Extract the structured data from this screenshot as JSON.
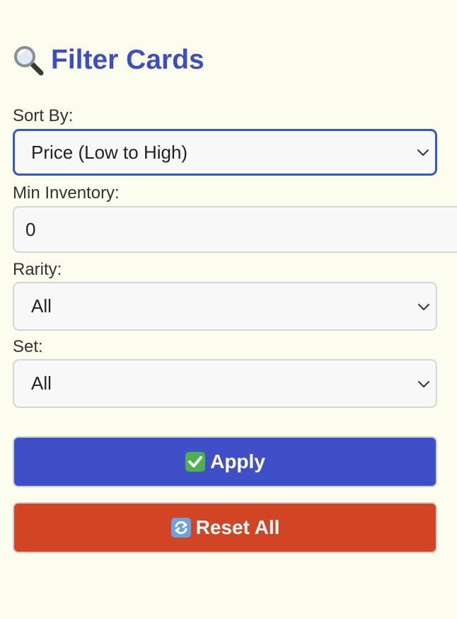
{
  "header": {
    "title": "Filter Cards",
    "title_icon": "magnifying-glass-icon"
  },
  "filters": {
    "sort_by": {
      "label": "Sort By:",
      "value": "Price (Low to High)"
    },
    "min_inventory": {
      "label": "Min Inventory:",
      "value": "0"
    },
    "rarity": {
      "label": "Rarity:",
      "value": "All"
    },
    "set": {
      "label": "Set:",
      "value": "All"
    }
  },
  "actions": {
    "apply_label": "Apply",
    "apply_icon": "check-mark-button-icon",
    "reset_label": "Reset All",
    "reset_icon": "refresh-arrows-icon"
  },
  "colors": {
    "page_background": "#fdfdef",
    "title": "#3c4ec4",
    "focus_border": "#3558c4",
    "apply_button": "#3e4fc7",
    "reset_button": "#d24524"
  }
}
